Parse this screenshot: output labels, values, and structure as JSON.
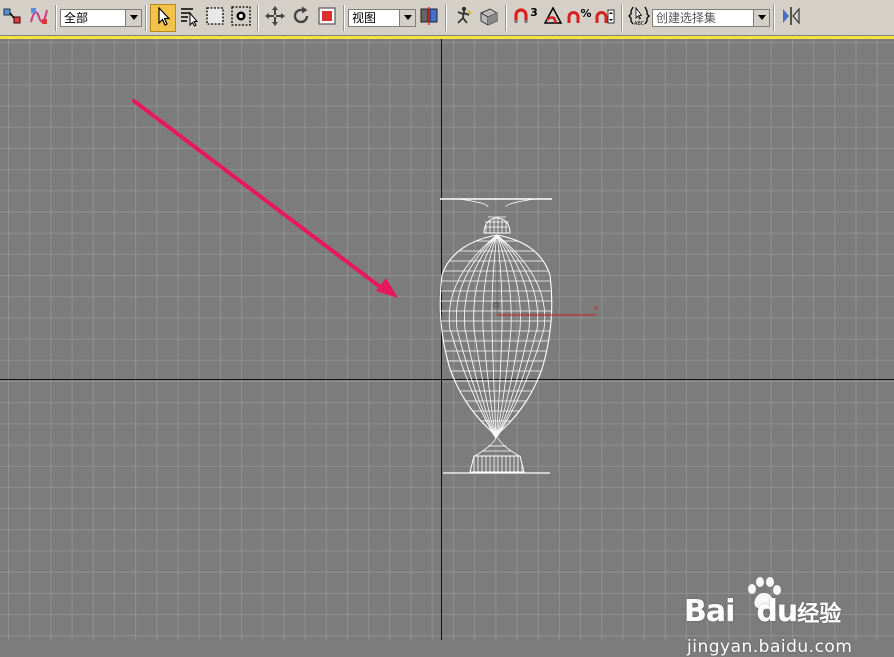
{
  "toolbar": {
    "selection_filter": "全部",
    "reference_coord": "视图",
    "named_selection_placeholder": "创建选择集",
    "snap_label": "3",
    "percent_label": "%"
  },
  "viewport": {
    "axis_label": "x"
  },
  "watermark": {
    "brand": "Bai",
    "brand_du": "du",
    "brand_cn": "经验",
    "url": "jingyan.baidu.com"
  },
  "colors": {
    "toolbar_bg": "#d4d0c8",
    "viewport_bg": "#7c7c7c",
    "active_tool": "#f3c24a",
    "highlight_border": "#f3e33b",
    "arrow": "#e8185e",
    "wireframe": "#ffffff",
    "axis_x": "#cc2020"
  },
  "icons": [
    "link-icon",
    "bind-spacewarp-icon",
    "select-object-icon",
    "select-by-name-icon",
    "rect-region-icon",
    "window-crossing-icon",
    "move-icon",
    "rotate-icon",
    "scale-icon",
    "pivot-icon",
    "manipulate-icon",
    "keyboard-shortcut-icon",
    "snap-3d-icon",
    "angle-snap-icon",
    "percent-snap-icon",
    "spinner-snap-icon",
    "edit-named-selection-icon",
    "mirror-icon"
  ]
}
